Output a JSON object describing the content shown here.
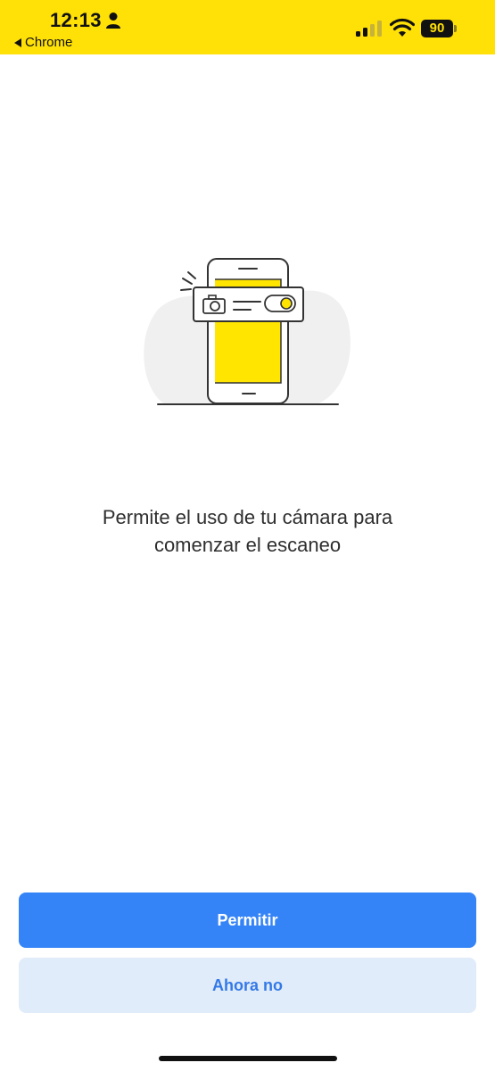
{
  "status_bar": {
    "time": "12:13",
    "back_app": "Chrome",
    "battery_level": "90",
    "background_color": "#FFE007",
    "icons": [
      "person-icon",
      "back-arrow-icon",
      "signal-icon",
      "wifi-icon",
      "battery-icon"
    ]
  },
  "illustration": {
    "icons": [
      "phone-illustration",
      "camera-icon",
      "toggle-switch-icon"
    ],
    "accent_color": "#FFE500"
  },
  "message": {
    "line1": "Permite el uso de tu cámara para",
    "line2": "comenzar el escaneo"
  },
  "actions": {
    "allow_label": "Permitir",
    "deny_label": "Ahora no",
    "allow_color": "#3584F7",
    "deny_color": "#E1ECFB"
  }
}
